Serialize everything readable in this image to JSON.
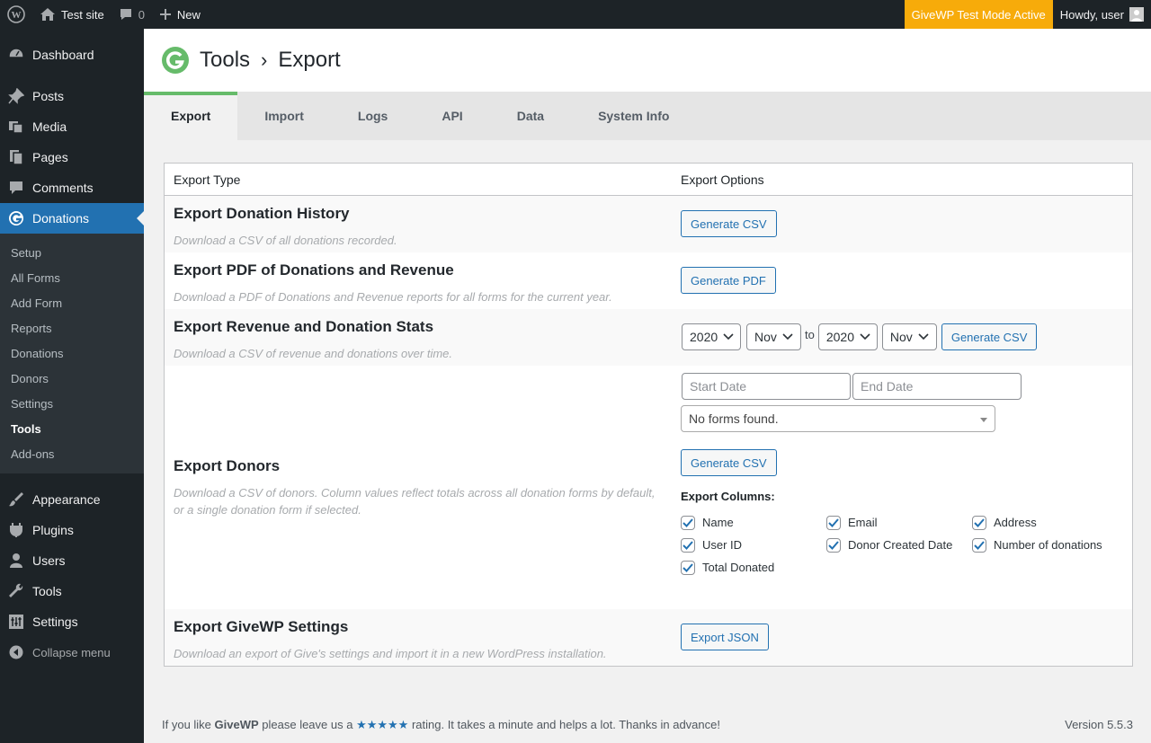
{
  "adminbar": {
    "site_name": "Test site",
    "comments_count": "0",
    "new_label": "New",
    "test_mode": "GiveWP Test Mode Active",
    "howdy": "Howdy, user"
  },
  "sidebar": {
    "items_top": [
      {
        "label": "Dashboard",
        "icon": "dashboard-icon"
      }
    ],
    "items_mid": [
      {
        "label": "Posts",
        "icon": "pushpin-icon"
      },
      {
        "label": "Media",
        "icon": "media-icon"
      },
      {
        "label": "Pages",
        "icon": "pages-icon"
      },
      {
        "label": "Comments",
        "icon": "comments-icon"
      },
      {
        "label": "Donations",
        "icon": "give-icon"
      }
    ],
    "submenu": [
      "Setup",
      "All Forms",
      "Add Form",
      "Reports",
      "Donations",
      "Donors",
      "Settings",
      "Tools",
      "Add-ons"
    ],
    "items_bottom": [
      {
        "label": "Appearance",
        "icon": "appearance-icon"
      },
      {
        "label": "Plugins",
        "icon": "plugins-icon"
      },
      {
        "label": "Users",
        "icon": "users-icon"
      },
      {
        "label": "Tools",
        "icon": "tools-icon"
      },
      {
        "label": "Settings",
        "icon": "settings-icon"
      }
    ],
    "collapse": "Collapse menu"
  },
  "header": {
    "title": "Tools",
    "separator": "›",
    "subtitle": "Export"
  },
  "tabs": [
    "Export",
    "Import",
    "Logs",
    "API",
    "Data",
    "System Info"
  ],
  "table": {
    "col_type": "Export Type",
    "col_options": "Export Options",
    "donation_history": {
      "title": "Export Donation History",
      "desc": "Download a CSV of all donations recorded.",
      "button": "Generate CSV"
    },
    "pdf": {
      "title": "Export PDF of Donations and Revenue",
      "desc": "Download a PDF of Donations and Revenue reports for all forms for the current year.",
      "button": "Generate PDF"
    },
    "stats": {
      "title": "Export Revenue and Donation Stats",
      "desc": "Download a CSV of revenue and donations over time.",
      "start_year": "2020",
      "start_month": "Nov",
      "to": "to",
      "end_year": "2020",
      "end_month": "Nov",
      "button": "Generate CSV"
    },
    "donors": {
      "title": "Export Donors",
      "desc": "Download a CSV of donors. Column values reflect totals across all donation forms by default, or a single donation form if selected.",
      "start_placeholder": "Start Date",
      "end_placeholder": "End Date",
      "forms_select": "No forms found.",
      "button": "Generate CSV",
      "columns_label": "Export Columns:",
      "columns": [
        "Name",
        "Email",
        "Address",
        "User ID",
        "Donor Created Date",
        "Number of donations",
        "Total Donated"
      ]
    },
    "settings": {
      "title": "Export GiveWP Settings",
      "desc": "Download an export of Give's settings and import it in a new WordPress installation.",
      "button": "Export JSON"
    }
  },
  "footer": {
    "pre": "If you like ",
    "brand": "GiveWP",
    "mid": " please leave us a ",
    "stars": "★★★★★",
    "post": " rating. It takes a minute and helps a lot. Thanks in advance!",
    "version": "Version 5.5.3"
  }
}
